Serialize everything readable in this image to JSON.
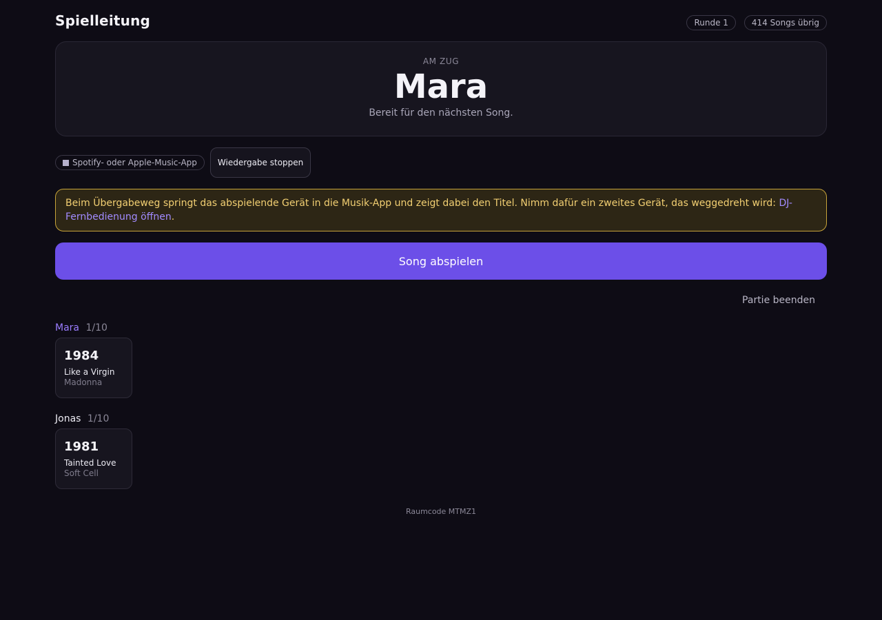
{
  "header": {
    "title": "Spielleitung",
    "round_badge": "Runde 1",
    "songs_badge": "414 Songs übrig"
  },
  "turn": {
    "label": "AM ZUG",
    "player": "Mara",
    "status": "Bereit für den nächsten Song."
  },
  "controls": {
    "app_chip": "Spotify- oder Apple-Music-App",
    "stop_button": "Wiedergabe stoppen"
  },
  "notice": {
    "text": "Beim Übergabeweg springt das abspielende Gerät in die Musik-App und zeigt dabei den Titel. Nimm dafür ein zweites Gerät, das weggedreht wird: ",
    "link": "DJ-Fernbedienung öffnen",
    "suffix": "."
  },
  "play_button": "Song abspielen",
  "end_button": "Partie beenden",
  "players": [
    {
      "name": "Mara",
      "score": "1/10",
      "cards": [
        {
          "year": "1984",
          "title": "Like a Virgin",
          "artist": "Madonna"
        }
      ]
    },
    {
      "name": "Jonas",
      "score": "1/10",
      "cards": [
        {
          "year": "1981",
          "title": "Tainted Love",
          "artist": "Soft Cell"
        }
      ]
    }
  ],
  "footer": "Raumcode MTMZ1",
  "colors": {
    "background": "#0e0c15",
    "accent": "#6c4fe8",
    "active_player": "#9b7dff",
    "notice_border": "#c8a43a",
    "notice_text": "#f2cf72"
  }
}
